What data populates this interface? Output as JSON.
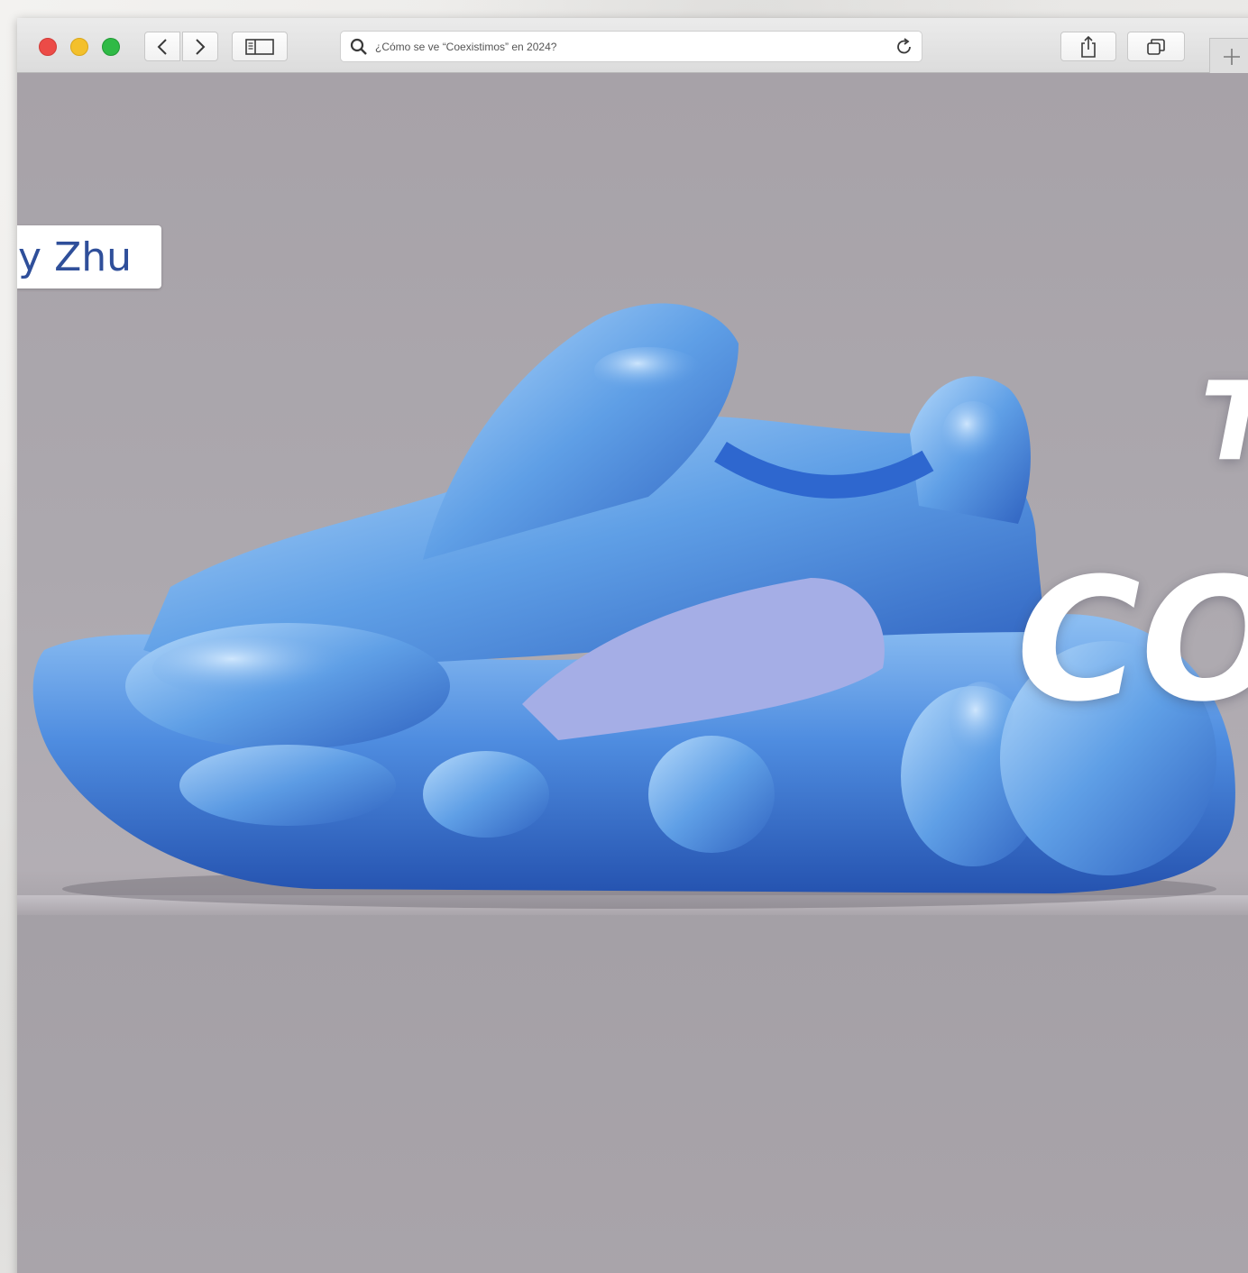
{
  "browser": {
    "url_text": "¿Cómo se ve “Coexistimos” en 2024?",
    "icons": [
      "close-dot",
      "minimize-dot",
      "zoom-dot",
      "chevron-left-icon",
      "chevron-right-icon",
      "sidebar-icon",
      "search-icon",
      "reload-icon",
      "share-icon",
      "tabs-icon",
      "plus-icon"
    ]
  },
  "page": {
    "name_chip_text": "y Zhu",
    "headline_top": "Th",
    "headline_big": "CO"
  },
  "colors": {
    "chip_text": "#2f4f9a",
    "headline": "#ffffff",
    "shoe": "#4f8de0"
  }
}
